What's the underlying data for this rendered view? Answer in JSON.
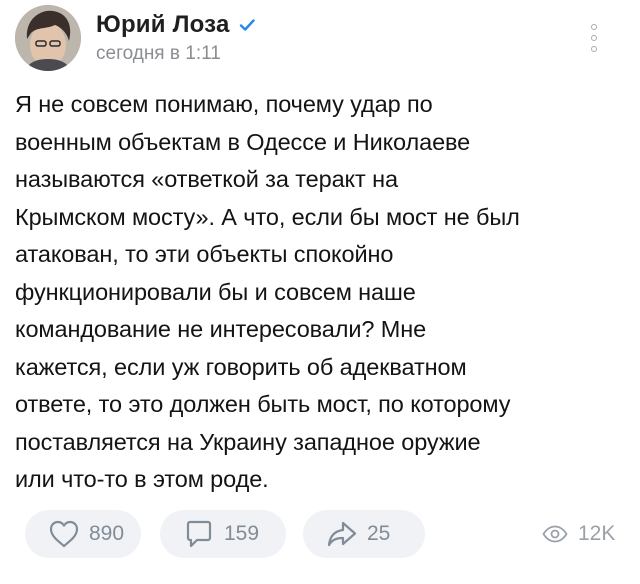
{
  "post": {
    "author": {
      "name": "Юрий Лоза",
      "verified": true,
      "avatar_icon": "user-avatar-photo"
    },
    "time": "сегодня в 1:11",
    "more_icon": "more-vertical-icon",
    "text": "Я не совсем понимаю, почему удар по\nвоенным объектам в Одессе и Николаеве\nназываются  «ответкой за теракт на\nКрымском мосту». А что, если бы мост не был\nатакован, то эти объекты спокойно\nфункционировали бы и совсем наше\nкомандование не интересовали? Мне\nкажется, если уж говорить об адекватном\nответе, то это должен быть мост, по которому\nпоставляется на Украину западное оружие\nили что-то в этом роде.",
    "actions": {
      "likes": {
        "icon": "heart-icon",
        "count": "890"
      },
      "comments": {
        "icon": "comment-icon",
        "count": "159"
      },
      "shares": {
        "icon": "share-icon",
        "count": "25"
      },
      "views": {
        "icon": "eye-icon",
        "count": "12K"
      }
    }
  },
  "colors": {
    "accent": "#2688eb",
    "secondary_text": "#818c99",
    "button_bg": "#f0f2f5"
  }
}
